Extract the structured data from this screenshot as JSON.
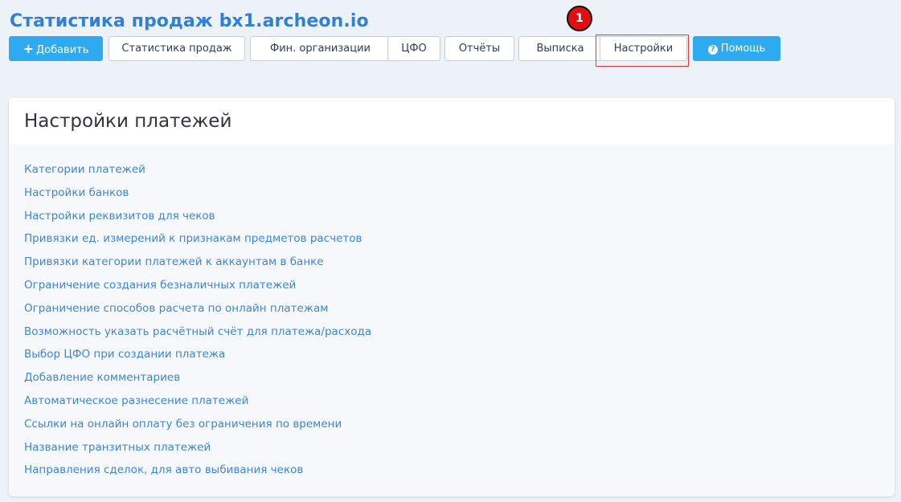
{
  "app_title": "Статистика продаж bx1.archeon.io",
  "toolbar": {
    "add_label": "Добавить",
    "sales_stats_label": "Статистика продаж",
    "fin_orgs_label": "Фин. организации",
    "cfo_label": "ЦФО",
    "reports_label": "Отчёты",
    "statement_label": "Выписка",
    "settings_label": "Настройки",
    "help_label": "Помощь"
  },
  "annotation": {
    "step_number": "1"
  },
  "icons": {
    "add": "plus-icon",
    "help": "question-circle-icon"
  },
  "colors": {
    "accent": "#2eaaf0",
    "title": "#2f80d8",
    "link": "#3d86d4",
    "highlight": "#e53935",
    "badge": "#e01010"
  },
  "panel": {
    "title": "Настройки платежей",
    "links": [
      "Категории платежей",
      "Настройки банков",
      "Настройки реквизитов для чеков",
      "Привязки ед. измерений к признакам предметов расчетов",
      "Привязки категории платежей к аккаунтам в банке",
      "Ограничение создания безналичных платежей",
      "Ограничение способов расчета по онлайн платежам",
      "Возможность указать расчётный счёт для платежа/расхода",
      "Выбор ЦФО при создании платежа",
      "Добавление комментариев",
      "Автоматическое разнесение платежей",
      "Ссылки на онлайн оплату без ограничения по времени",
      "Название транзитных платежей",
      "Направления сделок, для авто выбивания чеков"
    ]
  }
}
